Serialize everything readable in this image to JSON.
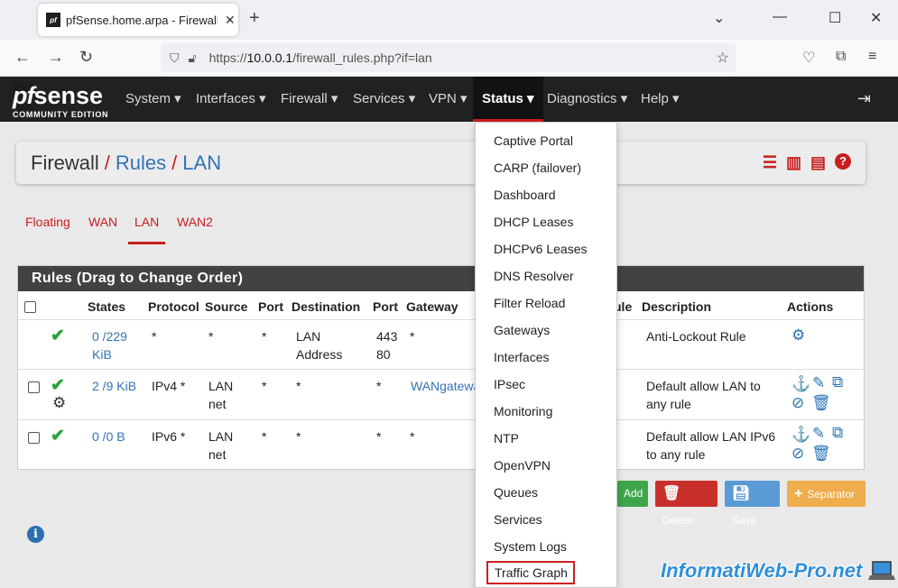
{
  "browser": {
    "tab_title": "pfSense.home.arpa - Firewall: R",
    "favicon_text": "pf",
    "url_prefix": "https://",
    "url_host": "10.0.0.1",
    "url_path": "/firewall_rules.php?if=lan"
  },
  "header": {
    "logo_pf": "pf",
    "logo_sense": "sense",
    "logo_edition": "COMMUNITY EDITION",
    "menu": [
      "System",
      "Interfaces",
      "Firewall",
      "Services",
      "VPN",
      "Status",
      "Diagnostics",
      "Help"
    ],
    "active_menu": "Status"
  },
  "breadcrumb": {
    "part1": "Firewall",
    "part2": "Rules",
    "part3": "LAN",
    "sep": "/"
  },
  "subtabs": [
    "Floating",
    "WAN",
    "LAN",
    "WAN2"
  ],
  "rules": {
    "title": "Rules (Drag to Change Order)",
    "columns": [
      "States",
      "Protocol",
      "Source",
      "Port",
      "Destination",
      "Port",
      "Gateway",
      "ule",
      "Description",
      "Actions"
    ],
    "rows": [
      {
        "states": "0 /229 KiB",
        "protocol": "*",
        "source": "*",
        "sport": "*",
        "destination": "LAN Address",
        "dport": "443 80",
        "gateway": "*",
        "description": "Anti-Lockout Rule"
      },
      {
        "states": "2 /9 KiB",
        "protocol": "IPv4 *",
        "source": "LAN net",
        "sport": "*",
        "destination": "*",
        "dport": "*",
        "gateway": "WANgatewa",
        "description": "Default allow LAN to any rule"
      },
      {
        "states": "0 /0 B",
        "protocol": "IPv6 *",
        "source": "LAN net",
        "sport": "*",
        "destination": "*",
        "dport": "*",
        "gateway": "*",
        "description": "Default allow LAN IPv6 to any rule"
      }
    ]
  },
  "buttons": {
    "add": "Add",
    "delete": "Delete",
    "save": "Save",
    "separator": "Separator"
  },
  "status_menu": [
    "Captive Portal",
    "CARP (failover)",
    "Dashboard",
    "DHCP Leases",
    "DHCPv6 Leases",
    "DNS Resolver",
    "Filter Reload",
    "Gateways",
    "Interfaces",
    "IPsec",
    "Monitoring",
    "NTP",
    "OpenVPN",
    "Queues",
    "Services",
    "System Logs",
    "Traffic Graph"
  ],
  "highlighted_item": "Traffic Graph",
  "watermark": "InformatiWeb-Pro.net",
  "colors": {
    "accent": "#c81e1e",
    "link": "#3273b5",
    "nav_bg": "#212121",
    "ok": "#2aa33a"
  }
}
